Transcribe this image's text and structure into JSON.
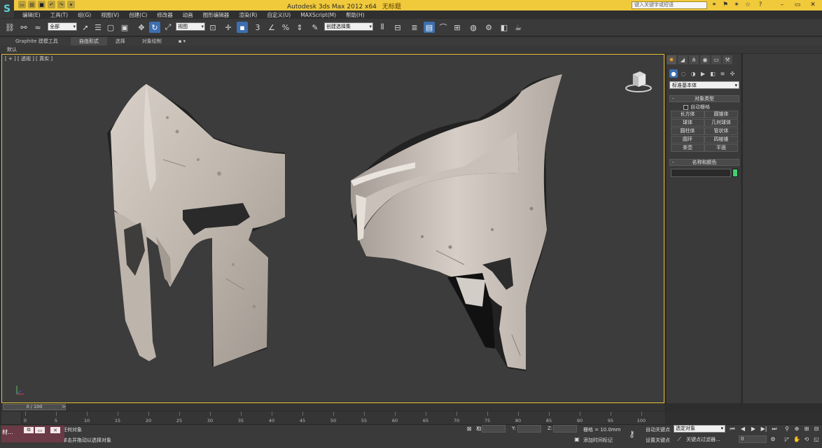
{
  "window": {
    "title": "Autodesk 3ds Max  2012 x64",
    "file": "无标题",
    "search_placeholder": "键入关键字或短语"
  },
  "menu": [
    "编辑(E)",
    "工具(T)",
    "组(G)",
    "视图(V)",
    "创建(C)",
    "修改器",
    "动画",
    "图形编辑器",
    "渲染(R)",
    "自定义(U)",
    "MAXScript(M)",
    "帮助(H)"
  ],
  "toolbar": {
    "selection_filter": "全部",
    "reference_coord": "视图",
    "named_selection": "创建选择集"
  },
  "ribbon": {
    "tabs": [
      "Graphite 建模工具",
      "自由形式",
      "选择",
      "对象绘制"
    ],
    "active_tab": 1,
    "sub_label": "默认"
  },
  "viewport": {
    "label": "[ + ] [ 透视 ] [ 真实 ]",
    "border_color": "#e9c23a"
  },
  "command_panel": {
    "category": "标准基本体",
    "rollout_object_type": "对象类型",
    "autogrid_label": "自动栅格",
    "autogrid_checked": false,
    "objects": [
      "长方体",
      "圆锥体",
      "球体",
      "几何球体",
      "圆柱体",
      "管状体",
      "圆环",
      "四棱锥",
      "茶壶",
      "平面"
    ],
    "rollout_name_color": "名称和颜色",
    "object_color": "#3fd36c"
  },
  "timeline": {
    "frame_display": "0 / 100",
    "ticks": [
      0,
      5,
      10,
      15,
      20,
      25,
      30,
      35,
      40,
      45,
      50,
      55,
      60,
      65,
      70,
      75,
      80,
      85,
      90,
      95,
      100
    ]
  },
  "status": {
    "mini_window_title": "材...",
    "selection_status": "未选定任何对象",
    "prompt": "单击或单击并拖动以选择对象",
    "x_label": "X:",
    "y_label": "Y:",
    "z_label": "Z:",
    "grid": "栅格 = 10.0mm",
    "add_time_tag": "添加时间标记",
    "auto_key": "自动关键点",
    "set_key": "设置关键点",
    "selected_object": "选定对象",
    "key_filters": "关键点过滤器...",
    "current_frame": "0"
  }
}
